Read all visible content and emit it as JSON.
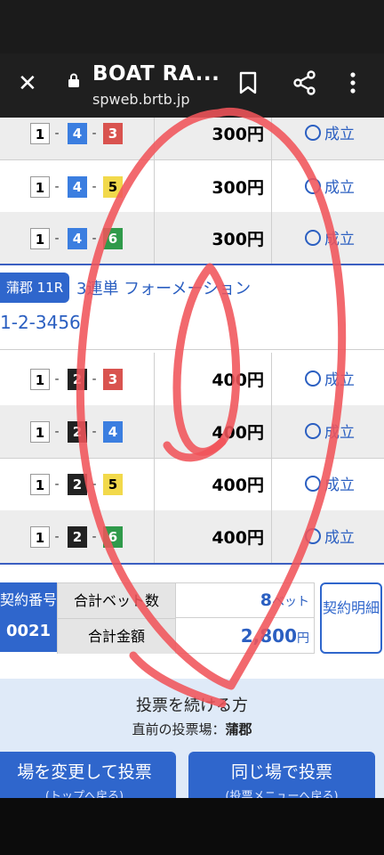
{
  "browser": {
    "title": "BOAT RA...",
    "url": "spweb.brtb.jp"
  },
  "rows_top": [
    {
      "combo": [
        "1",
        "4",
        "3"
      ],
      "amount": "300円",
      "status": "成立"
    },
    {
      "combo": [
        "1",
        "4",
        "5"
      ],
      "amount": "300円",
      "status": "成立"
    },
    {
      "combo": [
        "1",
        "4",
        "6"
      ],
      "amount": "300円",
      "status": "成立"
    }
  ],
  "bet": {
    "venue": "蒲郡 11R",
    "type": "3連単 フォーメーション",
    "combination": "1-2-3456"
  },
  "rows_bottom": [
    {
      "combo": [
        "1",
        "2",
        "3"
      ],
      "amount": "400円",
      "status": "成立"
    },
    {
      "combo": [
        "1",
        "2",
        "4"
      ],
      "amount": "400円",
      "status": "成立"
    },
    {
      "combo": [
        "1",
        "2",
        "5"
      ],
      "amount": "400円",
      "status": "成立"
    },
    {
      "combo": [
        "1",
        "2",
        "6"
      ],
      "amount": "400円",
      "status": "成立"
    }
  ],
  "summary": {
    "contract_label": "契約番号",
    "contract_number": "0021",
    "bet_count_label": "合計ベット数",
    "bet_count": "8",
    "bet_unit": "ベット",
    "total_label": "合計金額",
    "total_amount": "2,800",
    "currency": "円",
    "detail_button": "契約明細"
  },
  "continue": {
    "heading": "投票を続ける方",
    "last_venue_label": "直前の投票場：",
    "last_venue": "蒲郡",
    "change_venue_button": "場を変更して投票",
    "change_venue_sub": "(トップへ戻る)",
    "same_venue_button": "同じ場で投票",
    "same_venue_sub": "(投票メニューへ戻る)"
  },
  "colors": {
    "accent": "#2f66cc",
    "link": "#2b5fc1",
    "annotation": "#f0545a"
  }
}
